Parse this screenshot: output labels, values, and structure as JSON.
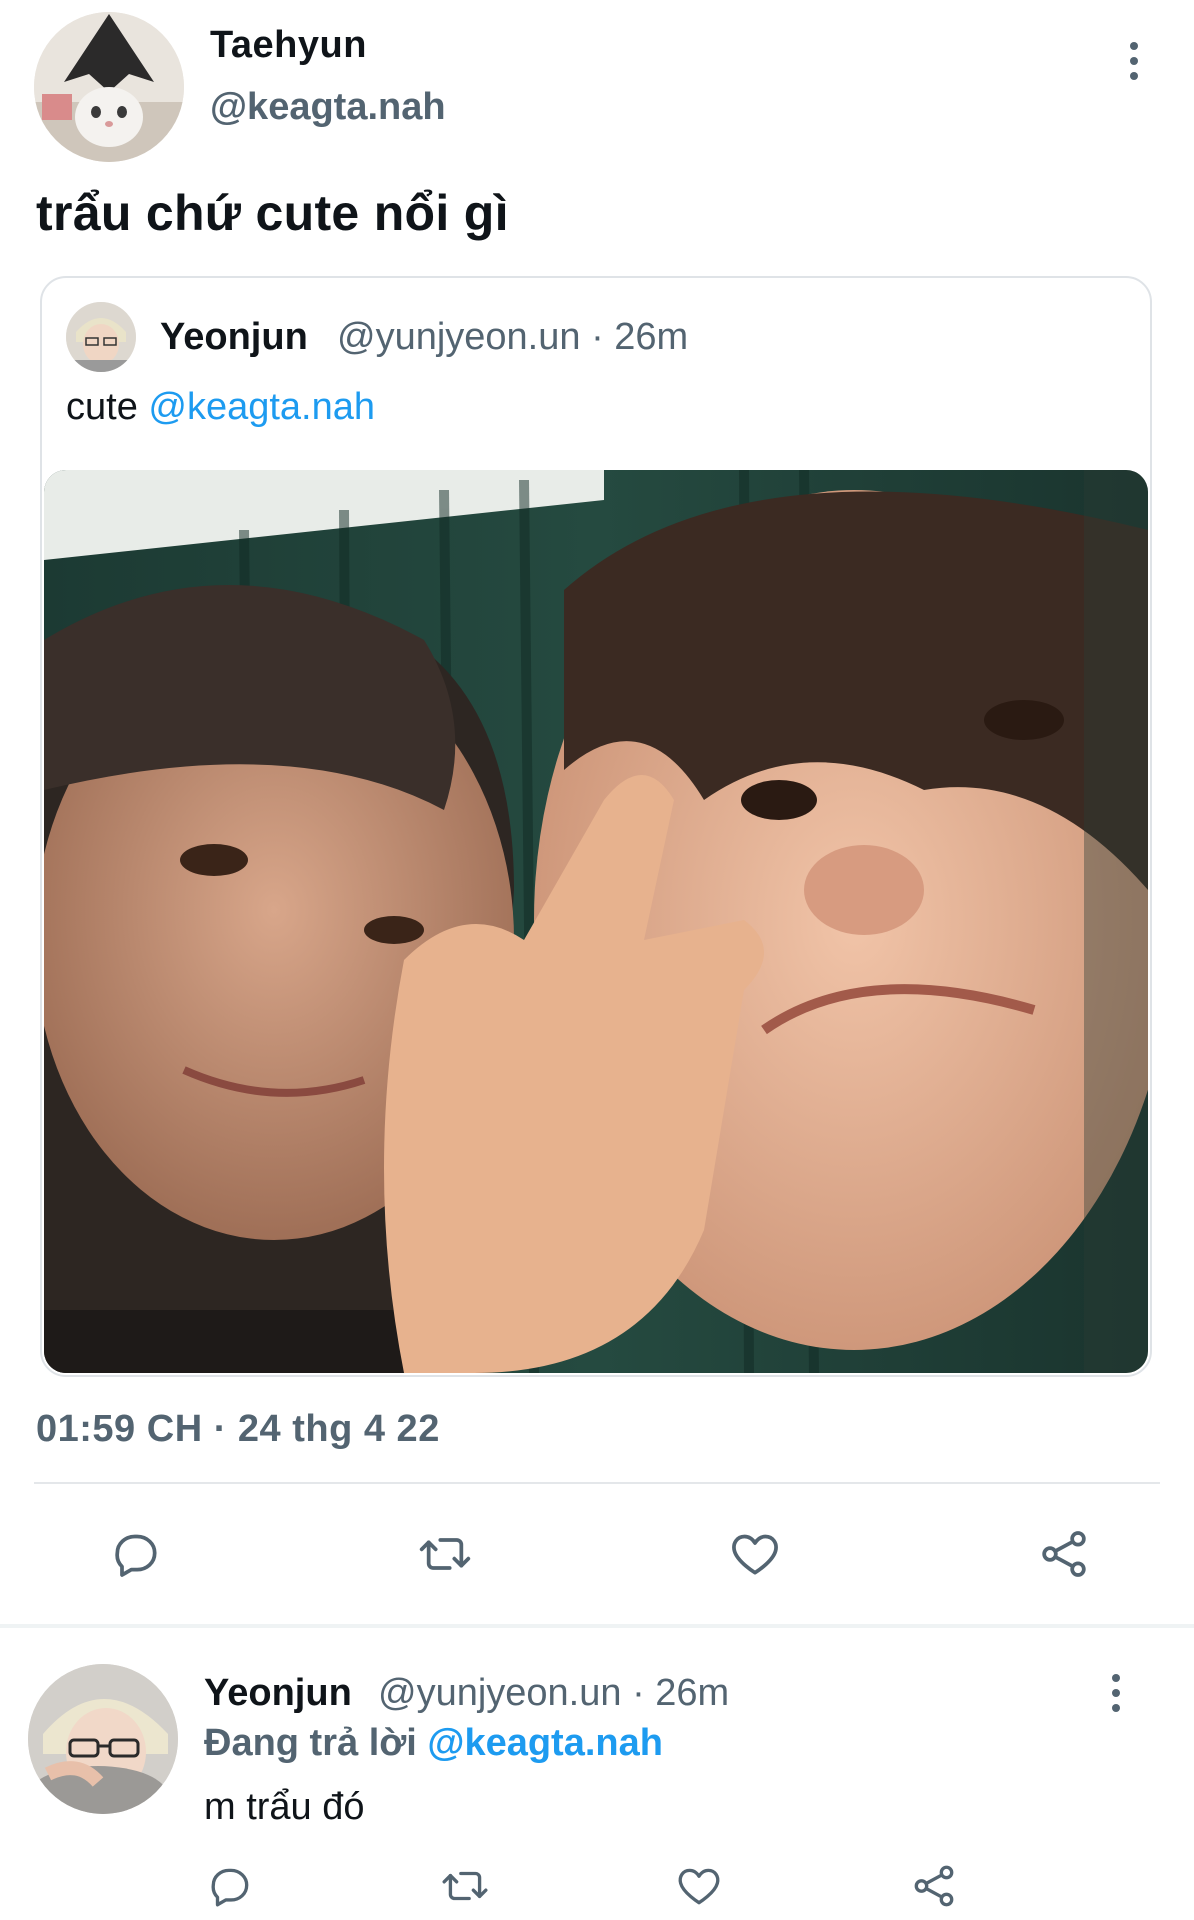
{
  "tweet": {
    "author": {
      "display_name": "Taehyun",
      "handle": "@keagta.nah",
      "avatar_icon": "cat-avatar"
    },
    "text": "trẩu chứ cute nổi gì",
    "quoted": {
      "display_name": "Yeonjun",
      "meta": "@yunjyeon.un · 26m",
      "text_prefix": "cute ",
      "mention": "@keagta.nah",
      "media_icon": "photo"
    },
    "timestamp": "01:59 CH · 24 thg 4 22",
    "actions": [
      "reply-icon",
      "retweet-icon",
      "like-icon",
      "share-icon"
    ]
  },
  "reply": {
    "display_name": "Yeonjun",
    "meta": "@yunjyeon.un · 26m",
    "context_prefix": "Đang trả lời ",
    "context_mention": "@keagta.nah",
    "text": "m trẩu đó",
    "actions": [
      "reply-icon",
      "retweet-icon",
      "like-icon",
      "share-icon"
    ]
  },
  "colors": {
    "accent": "#1d9bf0",
    "secondary_text": "#536471",
    "primary_text": "#0f1419",
    "border": "#dfe3e7"
  }
}
